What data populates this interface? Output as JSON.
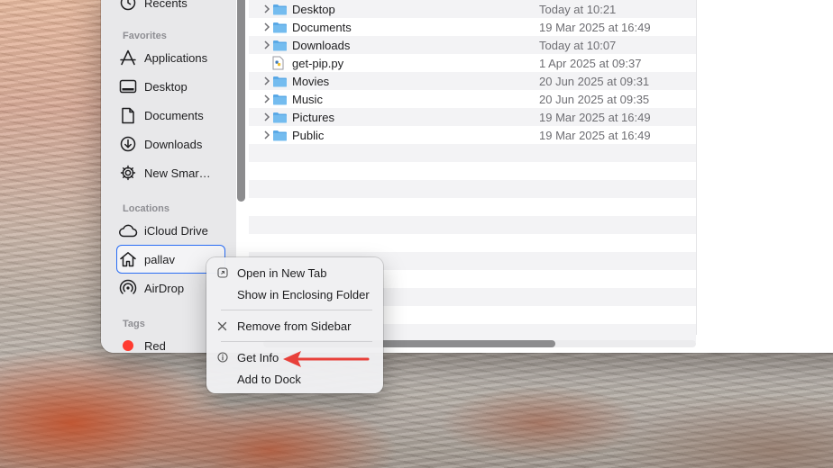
{
  "sidebar": {
    "recents_label": "Recents",
    "favorites_header": "Favorites",
    "favorites": [
      {
        "label": "Applications",
        "icon": "applications-icon"
      },
      {
        "label": "Desktop",
        "icon": "desktop-icon"
      },
      {
        "label": "Documents",
        "icon": "document-icon"
      },
      {
        "label": "Downloads",
        "icon": "downloads-icon"
      },
      {
        "label": "New Smar…",
        "icon": "gear-icon"
      }
    ],
    "locations_header": "Locations",
    "locations": [
      {
        "label": "iCloud Drive",
        "icon": "cloud-icon"
      },
      {
        "label": "pallav",
        "icon": "home-icon",
        "selected": true
      },
      {
        "label": "AirDrop",
        "icon": "airdrop-icon"
      }
    ],
    "tags_header": "Tags",
    "tags": [
      {
        "label": "Red",
        "color": "#ff3b30"
      }
    ]
  },
  "files": [
    {
      "name": "Desktop",
      "date": "Today at 10:21",
      "kind": "folder"
    },
    {
      "name": "Documents",
      "date": "19 Mar 2025 at 16:49",
      "kind": "folder"
    },
    {
      "name": "Downloads",
      "date": "Today at 10:07",
      "kind": "folder"
    },
    {
      "name": "get-pip.py",
      "date": "1 Apr 2025 at 09:37",
      "kind": "python-file"
    },
    {
      "name": "Movies",
      "date": "20 Jun 2025 at 09:31",
      "kind": "folder"
    },
    {
      "name": "Music",
      "date": "20 Jun 2025 at 09:35",
      "kind": "folder"
    },
    {
      "name": "Pictures",
      "date": "19 Mar 2025 at 16:49",
      "kind": "folder"
    },
    {
      "name": "Public",
      "date": "19 Mar 2025 at 16:49",
      "kind": "folder"
    }
  ],
  "context_menu": {
    "open_in_new_tab": "Open in New Tab",
    "show_in_enclosing_folder": "Show in Enclosing Folder",
    "remove_from_sidebar": "Remove from Sidebar",
    "get_info": "Get Info",
    "add_to_dock": "Add to Dock"
  },
  "colors": {
    "accent": "#2a6df4",
    "folder": "#5aa9e6",
    "annotation_arrow": "#e8403a",
    "tag_red": "#ff3b30"
  }
}
